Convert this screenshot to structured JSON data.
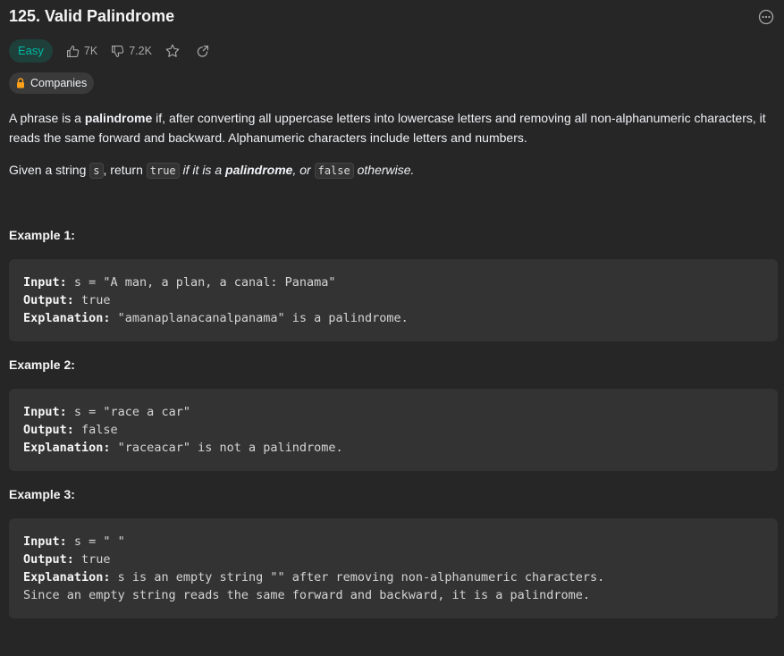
{
  "problem": {
    "title": "125. Valid Palindrome",
    "difficulty": "Easy",
    "likes": "7K",
    "dislikes": "7.2K",
    "companies_label": "Companies"
  },
  "description": {
    "p1_a": "A phrase is a ",
    "p1_bold": "palindrome",
    "p1_b": " if, after converting all uppercase letters into lowercase letters and removing all non-alphanumeric characters, it reads the same forward and backward. Alphanumeric characters include letters and numbers.",
    "p2_a": "Given a string ",
    "p2_code_s": "s",
    "p2_b": ", return ",
    "p2_code_true": "true",
    "p2_c": " if it is a ",
    "p2_bold": "palindrome",
    "p2_d": ", or ",
    "p2_code_false": "false",
    "p2_e": " otherwise."
  },
  "examples": [
    {
      "title": "Example 1:",
      "input_label": "Input:",
      "input": " s = \"A man, a plan, a canal: Panama\"",
      "output_label": "Output:",
      "output": " true",
      "explanation_label": "Explanation:",
      "explanation": " \"amanaplanacanalpanama\" is a palindrome."
    },
    {
      "title": "Example 2:",
      "input_label": "Input:",
      "input": " s = \"race a car\"",
      "output_label": "Output:",
      "output": " false",
      "explanation_label": "Explanation:",
      "explanation": " \"raceacar\" is not a palindrome."
    },
    {
      "title": "Example 3:",
      "input_label": "Input:",
      "input": " s = \" \"",
      "output_label": "Output:",
      "output": " true",
      "explanation_label": "Explanation:",
      "explanation": " s is an empty string \"\" after removing non-alphanumeric characters.",
      "explanation_2": "Since an empty string reads the same forward and backward, it is a palindrome."
    }
  ],
  "colors": {
    "background": "#262626",
    "easy": "#00b8a3",
    "lock": "#ffa116"
  }
}
